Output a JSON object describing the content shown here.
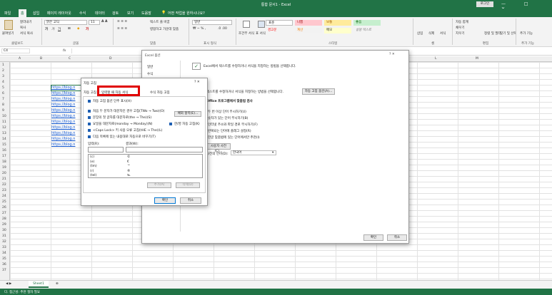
{
  "titlebar": {
    "title": "통합 문서1 - Excel",
    "login": "로그인",
    "controls": "—  □  ✕"
  },
  "tabs": [
    "파일",
    "홈",
    "삽입",
    "페이지 레이아웃",
    "수식",
    "데이터",
    "검토",
    "보기",
    "도움말"
  ],
  "search_placeholder": "어떤 작업을 원하시나요?",
  "ribbon": {
    "paste": "붙여넣기",
    "cut": "잘라내기",
    "copy": "복사",
    "format_painter": "서식 복사",
    "font_name": "맑은 고딕",
    "font_size": "11",
    "wrap": "텍스트 줄 바꿈",
    "merge": "병합하고 가운데 맞춤",
    "number_format": "일반",
    "conditional": "조건부 서식",
    "table_format": "표 서식",
    "insert": "삽입",
    "delete": "삭제",
    "format": "서식",
    "autosum": "자동 합계",
    "fill": "채우기",
    "clear": "지우기",
    "sort": "정렬 및 필터",
    "find": "찾기 및 선택",
    "addin": "추가 기능",
    "styles": [
      {
        "label": "표준",
        "bg": "#ffffff",
        "color": "#222222"
      },
      {
        "label": "나쁨",
        "bg": "#ffc7ce",
        "color": "#9c0006"
      },
      {
        "label": "보통",
        "bg": "#ffeb9c",
        "color": "#9c5700"
      },
      {
        "label": "좋음",
        "bg": "#c6efce",
        "color": "#006100"
      },
      {
        "label": "경고문",
        "bg": "#ffffff",
        "color": "#ff0000"
      },
      {
        "label": "계산",
        "bg": "#f2f2f2",
        "color": "#fa7d00"
      },
      {
        "label": "메모",
        "bg": "#ffffcc",
        "color": "#222222"
      },
      {
        "label": "설명 텍스트",
        "bg": "#ffffff",
        "color": "#7f7f7f"
      }
    ],
    "groups": [
      "클립보드",
      "글꼴",
      "맞춤",
      "표시 형식",
      "스타일",
      "셀",
      "편집",
      "추가 기능"
    ]
  },
  "formula_bar": {
    "name_box": "C4",
    "fx": "fx"
  },
  "columns": [
    "A",
    "B",
    "C",
    "D",
    "E",
    "F",
    "G",
    "H",
    "I",
    "J",
    "K",
    "L",
    "M"
  ],
  "rows": [
    "1",
    "2",
    "3",
    "4",
    "5",
    "6",
    "7",
    "8",
    "9",
    "10",
    "11",
    "12",
    "13",
    "14",
    "15",
    "16",
    "17",
    "18",
    "19",
    "20",
    "21",
    "22",
    "23",
    "24",
    "25",
    "26",
    "27",
    "28",
    "29",
    "30",
    "31",
    "32",
    "33",
    "34",
    "35",
    "36",
    "37"
  ],
  "links": [
    "https://blog.n",
    "https://blog.n",
    "https://blog.n",
    "https://blog.n",
    "https://blog.n",
    "https://blog.n",
    "https://blog.n",
    "https://blog.n",
    "https://blog.n",
    "https://blog.n",
    "https://blog.n"
  ],
  "sheet": {
    "tab": "Sheet1",
    "status": "다. 접근성: 추천 절차 필요"
  },
  "options_dialog": {
    "title": "Excel 옵션",
    "nav": [
      "일반",
      "수식"
    ],
    "heading": "Excel에서 텍스트를 수정하거나 서식을 지정하는 방법을 선택합니다.",
    "sub_text": "텍스트를 수정하거나 서식을 지정하는 방법을 선택합니다.",
    "autocorrect_btn": "자동 고침 옵션(A)...",
    "office_heading": "Office 프로그램에서 맞춤법 검사",
    "options": [
      "두 번 이상 단어 무시하기(U)",
      "숫자가 있는 단어 무시하기(B)",
      "인터넷 주소와 파일 경로 무시하기(F)",
      "반복되는 단어에 플래그 설정(R)",
      "한글 맞춤법에 있는 단어에서만 추천(I)"
    ],
    "dict_btn": "사용자 사전(C)...",
    "lang_label": "사전의 언어(D):",
    "lang_value": "한국어",
    "ok": "확인",
    "cancel": "취소",
    "title_controls": "?  ✕"
  },
  "autocorrect_dialog": {
    "title": "자동 고침",
    "title_controls": "?  ✕",
    "tabs": [
      "자동 고침",
      "입력할 때 자동 서식",
      "수식 자동 고침"
    ],
    "checks": [
      "자동 고침 옵션 단추 표시(H)",
      "처음 두 문자가 대문자인 경우 고침(TWo → Two)(O)",
      "문장의 첫 글자를 대문자로(the → The)(S)",
      "요일을 대문자로(monday → Monday)(N)",
      "<Caps Lock> 키 사용 오류 고침(tHE → The)(L)",
      "다음 목록에 있는 내용대로 자동으로 바꾸기(T)"
    ],
    "exceptions_btn": "예외 항목(E)...",
    "korean_check": "한/영 자동 고침(K)",
    "replace_label": "입력(R):",
    "with_label": "결과(W):",
    "list": [
      {
        "input": "(c)",
        "output": "©"
      },
      {
        "input": "(e)",
        "output": "€"
      },
      {
        "input": "(tm)",
        "output": "™"
      },
      {
        "input": "(r)",
        "output": "®"
      },
      {
        "input": "(tel)",
        "output": "℡"
      }
    ],
    "add_btn": "추가(A)",
    "delete_btn": "삭제(D)",
    "ok": "확인",
    "cancel": "취소",
    "highlight_color": "#e00000"
  }
}
